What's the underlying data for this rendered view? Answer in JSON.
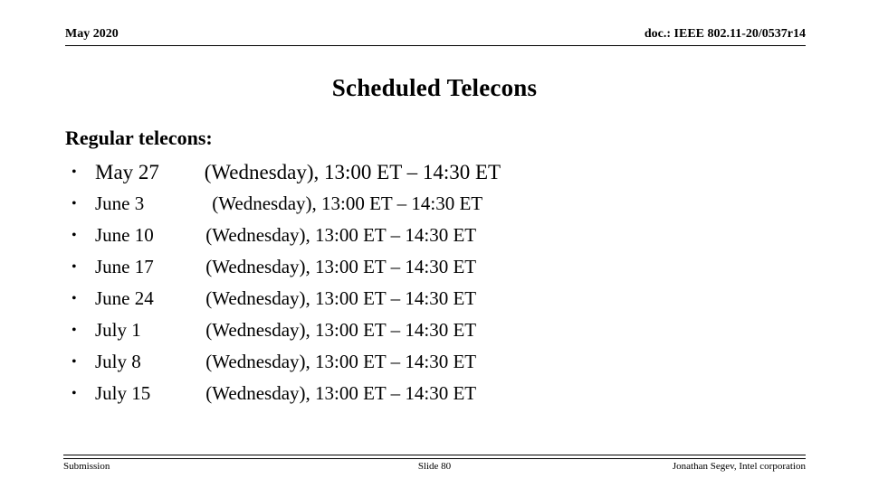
{
  "header": {
    "date": "May 2020",
    "doc_id": "doc.: IEEE 802.11-20/0537r14"
  },
  "title": "Scheduled Telecons",
  "body": {
    "heading": "Regular telecons:",
    "bullet_symbol": "•",
    "rows": [
      {
        "date": "May 27",
        "detail": "(Wednesday), 13:00 ET – 14:30 ET"
      },
      {
        "date": "June 3",
        "detail": "(Wednesday), 13:00 ET – 14:30 ET"
      },
      {
        "date": "June 10",
        "detail": "(Wednesday), 13:00 ET – 14:30 ET"
      },
      {
        "date": "June 17",
        "detail": "(Wednesday), 13:00 ET – 14:30 ET"
      },
      {
        "date": "June 24",
        "detail": "(Wednesday), 13:00 ET – 14:30 ET"
      },
      {
        "date": "July 1",
        "detail": "(Wednesday), 13:00 ET – 14:30 ET"
      },
      {
        "date": "July 8",
        "detail": "(Wednesday), 13:00 ET – 14:30 ET"
      },
      {
        "date": "July 15",
        "detail": "(Wednesday), 13:00 ET – 14:30 ET"
      }
    ]
  },
  "footer": {
    "left": "Submission",
    "center": "Slide 80",
    "right": "Jonathan Segev, Intel corporation"
  }
}
